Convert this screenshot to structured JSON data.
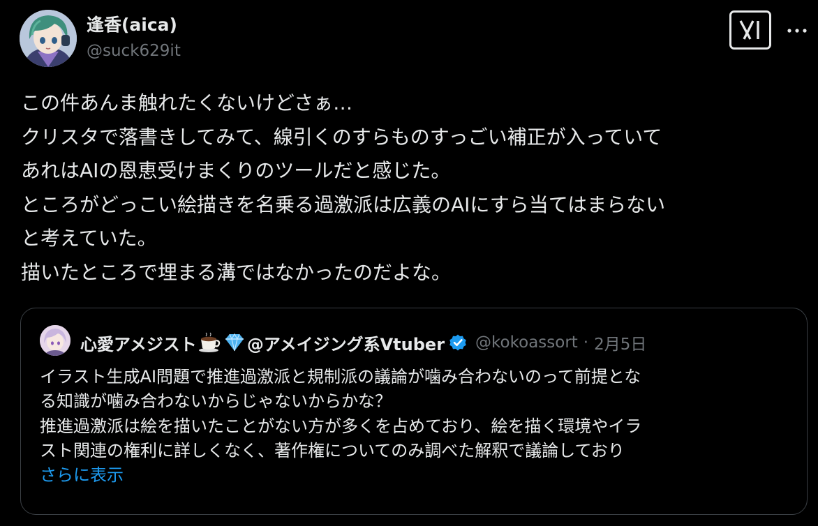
{
  "author": {
    "display_name": "逢香(aica)",
    "handle": "@suck629it"
  },
  "post": {
    "lines": [
      "この件あんま触れたくないけどさぁ…",
      "クリスタで落書きしてみて、線引くのすらものすっごい補正が入っていて",
      "あれはAIの恩恵受けまくりのツールだと感じた。",
      "ところがどっこい絵描きを名乗る過激派は広義のAIにすら当てはまらない",
      "と考えていた。",
      "描いたところで埋まる溝ではなかったのだよな。"
    ]
  },
  "quoted_post": {
    "display_name": "心愛アメジスト",
    "display_name_suffix": "@アメイジング系Vtuber",
    "emojis": [
      "coffee-cup-icon",
      "gem-icon"
    ],
    "handle": "@kokoassort",
    "separator": "·",
    "date": "2月5日",
    "lines": [
      "イラスト生成AI問題で推進過激派と規制派の議論が噛み合わないのって前提とな",
      "る知識が噛み合わないからじゃないからかな？",
      "推進過激派は絵を描いたことがない方が多くを占めており、絵を描く環境やイラ",
      "スト関連の権利に詳しくなく、著作権についてのみ調べた解釈で議論しており"
    ],
    "show_more": "さらに表示"
  },
  "colors": {
    "background": "#000000",
    "text": "#e7e9ea",
    "secondary": "#71767b",
    "link": "#1d9bf0",
    "border": "#3a3f44",
    "verified": "#1d9bf0"
  }
}
